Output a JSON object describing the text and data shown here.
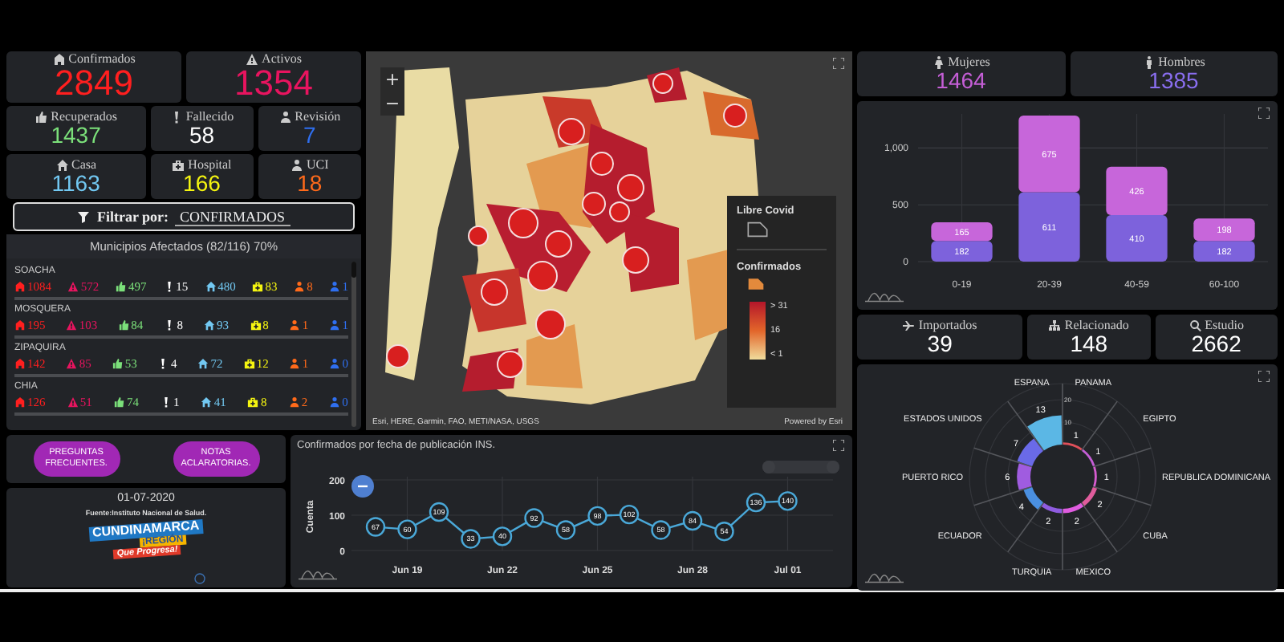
{
  "metrics_top": [
    {
      "label": "Confirmados",
      "value": "2849",
      "color": "#ff1f1f"
    },
    {
      "label": "Activos",
      "value": "1354",
      "color": "#e8145f"
    }
  ],
  "metrics_mid": [
    {
      "label": "Recuperados",
      "value": "1437",
      "color": "#7be07a"
    },
    {
      "label": "Fallecido",
      "value": "58",
      "color": "#ffffff"
    },
    {
      "label": "Revisión",
      "value": "7",
      "color": "#2f6ff0"
    }
  ],
  "metrics_low": [
    {
      "label": "Casa",
      "value": "1163",
      "color": "#72c8f2"
    },
    {
      "label": "Hospital",
      "value": "166",
      "color": "#f5f510"
    },
    {
      "label": "UCI",
      "value": "18",
      "color": "#ff6a1a"
    }
  ],
  "filter": {
    "label": "Filtrar por:",
    "value": "CONFIRMADOS"
  },
  "municipalities": {
    "title": "Municipios Afectados (82/116) 70%",
    "rows": [
      {
        "name": "SOACHA",
        "stats": [
          "1084",
          "572",
          "497",
          "15",
          "480",
          "83",
          "8",
          "1"
        ]
      },
      {
        "name": "MOSQUERA",
        "stats": [
          "195",
          "103",
          "84",
          "8",
          "93",
          "8",
          "1",
          "1"
        ]
      },
      {
        "name": "ZIPAQUIRA",
        "stats": [
          "142",
          "85",
          "53",
          "4",
          "72",
          "12",
          "1",
          "0"
        ]
      },
      {
        "name": "CHIA",
        "stats": [
          "126",
          "51",
          "74",
          "1",
          "41",
          "8",
          "2",
          "0"
        ]
      }
    ]
  },
  "links": [
    "PREGUNTAS FRECUENTES.",
    "NOTAS ACLARATORIAS."
  ],
  "info": {
    "date": "01-07-2020",
    "source": "Fuente:Instituto Nacional de Salud.",
    "logo": [
      "CUNDINAMARCA",
      "¡REGIÓN",
      "Que Progresa!"
    ]
  },
  "map": {
    "zoom": [
      "+",
      "−"
    ],
    "legend_title": "Libre Covid",
    "layer": "Confirmados",
    "scale": [
      "> 31",
      "16",
      "< 1"
    ],
    "attribution": "Esri, HERE, Garmin, FAO, METI/NASA, USGS",
    "powered": "Powered by Esri"
  },
  "timeline": {
    "title": "Confirmados por fecha de publicación INS.",
    "range_slider": {
      "level": 1
    },
    "chart_data": {
      "type": "line",
      "ylabel": "Cuenta",
      "categories": [
        null,
        "Jun 19",
        null,
        null,
        "Jun 22",
        null,
        null,
        "Jun 25",
        null,
        null,
        "Jun 28",
        null,
        null,
        "Jul 01"
      ],
      "series": [
        {
          "color": "#4aa8d8",
          "marker": "circle",
          "values": [
            67,
            60,
            109,
            33,
            40,
            92,
            58,
            98,
            102,
            58,
            84,
            54,
            136,
            140
          ]
        }
      ],
      "yticks": [
        0,
        100,
        200
      ],
      "ylim": [
        0,
        200
      ],
      "grid": true,
      "data_labels": true
    }
  },
  "gender": [
    {
      "label": "Mujeres",
      "value": "1464",
      "color": "#c45ed6"
    },
    {
      "label": "Hombres",
      "value": "1385",
      "color": "#8a6ef0"
    }
  ],
  "age_chart": {
    "chart_data": {
      "type": "bar",
      "stacked": true,
      "categories": [
        "0-19",
        "20-39",
        "40-59",
        "60-100"
      ],
      "series": [
        {
          "color": "#7d62dc",
          "values": [
            182,
            611,
            410,
            182
          ]
        },
        {
          "color": "#c766da",
          "values": [
            165,
            675,
            426,
            198
          ]
        }
      ],
      "yticks": [
        0,
        500,
        {
          "value": 1000,
          "label": "1,000"
        }
      ],
      "ylim": [
        0,
        1300
      ],
      "grid": true,
      "data_labels": true
    }
  },
  "origin": [
    {
      "label": "Importados",
      "value": "39"
    },
    {
      "label": "Relacionado",
      "value": "148"
    },
    {
      "label": "Estudio",
      "value": "2662"
    }
  ],
  "countries": {
    "ticks": [
      "20",
      "10"
    ],
    "items": [
      {
        "name": "ESPANA",
        "value": "13"
      },
      {
        "name": "PANAMA",
        "value": "1"
      },
      {
        "name": "ESTADOS UNIDOS",
        "value": "7"
      },
      {
        "name": "EGIPTO",
        "value": "1"
      },
      {
        "name": "PUERTO RICO",
        "value": "6"
      },
      {
        "name": "REPUBLICA DOMINICANA",
        "value": "1"
      },
      {
        "name": "ECUADOR",
        "value": "4"
      },
      {
        "name": "CUBA",
        "value": "2"
      },
      {
        "name": "TURQUIA",
        "value": "2"
      },
      {
        "name": "MEXICO",
        "value": "2"
      }
    ]
  }
}
